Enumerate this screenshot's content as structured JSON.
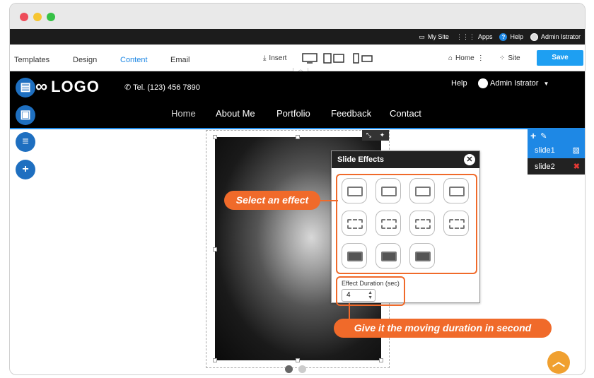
{
  "admin_bar": {
    "my_site": "My Site",
    "apps": "Apps",
    "help": "Help",
    "user": "Admin Istrator"
  },
  "toolbar": {
    "tabs": [
      "Templates",
      "Design",
      "Content",
      "Email"
    ],
    "active_tab": "Content",
    "insert": "Insert",
    "home": "Home",
    "site": "Site",
    "save": "Save"
  },
  "site_header": {
    "logo": "LOGO",
    "tel": "Tel. (123) 456 7890",
    "help": "Help",
    "user": "Admin Istrator",
    "nav": [
      "Home",
      "About Me",
      "Portfolio",
      "Feedback",
      "Contact"
    ]
  },
  "slide_panel": {
    "slides": [
      "slide1",
      "slide2"
    ]
  },
  "slide_effects": {
    "title": "Slide Effects",
    "duration_label": "Effect Duration (sec)",
    "duration_value": "4"
  },
  "callouts": {
    "select_effect": "Select an effect",
    "duration": "Give it the moving duration in second"
  },
  "colors": {
    "accent_blue": "#1e88e5",
    "callout_orange": "#f06a2a",
    "header_black": "#000000"
  }
}
